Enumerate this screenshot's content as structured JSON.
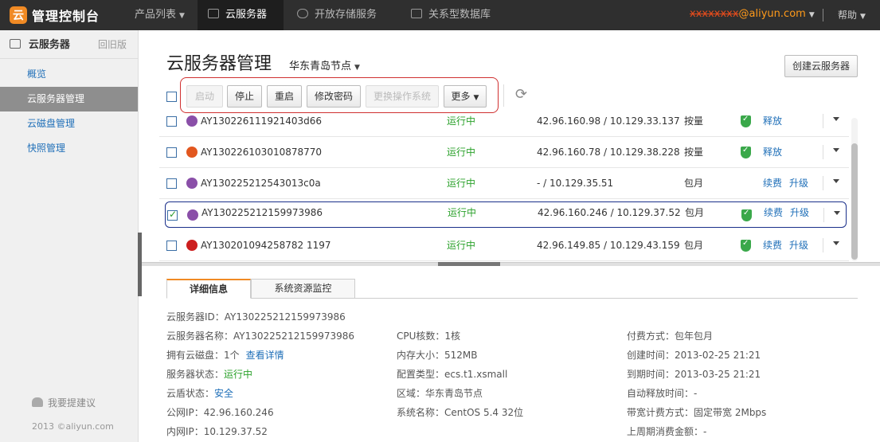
{
  "nav": {
    "logo_mark": "云",
    "logo_text": "管理控制台",
    "products": "产品列表",
    "ecs": "云服务器",
    "oss": "开放存储服务",
    "rds": "关系型数据库",
    "user_masked": "xxxxxxxx",
    "user_domain": "@aliyun.com",
    "help": "帮助"
  },
  "sidebar": {
    "title": "云服务器",
    "old_version": "回旧版",
    "items": [
      {
        "label": "概览"
      },
      {
        "label": "云服务器管理"
      },
      {
        "label": "云磁盘管理"
      },
      {
        "label": "快照管理"
      }
    ],
    "feedback": "我要提建议",
    "copyright": "2013 ©aliyun.com"
  },
  "page": {
    "title": "云服务器管理",
    "region": "华东青岛节点",
    "create_button": "创建云服务器"
  },
  "toolbar": {
    "start": "启动",
    "stop": "停止",
    "restart": "重启",
    "change_password": "修改密码",
    "change_os": "更换操作系统",
    "more": "更多"
  },
  "rows": [
    {
      "id": "AY130226111921403d66",
      "status": "运行中",
      "ip": "42.96.160.98 / 10.129.33.137",
      "billing": "按量",
      "a1": "释放",
      "a2": "",
      "os": "centos",
      "shield": true,
      "checked": false
    },
    {
      "id": "AY130226103010878770",
      "status": "运行中",
      "ip": "42.96.160.78 / 10.129.38.228",
      "billing": "按量",
      "a1": "释放",
      "a2": "",
      "os": "ubuntu",
      "shield": true,
      "checked": false
    },
    {
      "id": "AY130225212543013c0a",
      "status": "运行中",
      "ip": "- / 10.129.35.51",
      "billing": "包月",
      "a1": "续费",
      "a2": "升级",
      "os": "centos",
      "shield": false,
      "checked": false
    },
    {
      "id": "AY130225212159973986",
      "status": "运行中",
      "ip": "42.96.160.246 / 10.129.37.52",
      "billing": "包月",
      "a1": "续费",
      "a2": "升级",
      "os": "centos",
      "shield": true,
      "checked": true
    },
    {
      "id": "AY130201094258782 1197",
      "status": "运行中",
      "ip": "42.96.149.85 / 10.129.43.159",
      "billing": "包月",
      "a1": "续费",
      "a2": "升级",
      "os": "redhat",
      "shield": true,
      "checked": false
    }
  ],
  "detail": {
    "tab_info": "详细信息",
    "tab_monitor": "系统资源监控",
    "id_label": "云服务器ID：",
    "id": "AY130225212159973986",
    "col1": [
      {
        "k": "云服务器名称：",
        "v": "AY130225212159973986"
      },
      {
        "k": "拥有云磁盘：",
        "v": "1个"
      },
      {
        "k": "服务器状态：",
        "v": "运行中"
      },
      {
        "k": "云盾状态：",
        "v": "安全"
      },
      {
        "k": "公网IP：",
        "v": "42.96.160.246"
      },
      {
        "k": "内网IP：",
        "v": "10.129.37.52"
      }
    ],
    "view_details": "查看详情",
    "col2": [
      {
        "k": "CPU核数：",
        "v": "1核"
      },
      {
        "k": "内存大小：",
        "v": "512MB"
      },
      {
        "k": "配置类型：",
        "v": "ecs.t1.xsmall"
      },
      {
        "k": "区域：",
        "v": "华东青岛节点"
      },
      {
        "k": "系统名称：",
        "v": "CentOS 5.4 32位"
      }
    ],
    "col3": [
      {
        "k": "付费方式：",
        "v": "包年包月"
      },
      {
        "k": "创建时间：",
        "v": "2013-02-25  21:21"
      },
      {
        "k": "到期时间：",
        "v": "2013-03-25  21:21"
      },
      {
        "k": "自动释放时间：",
        "v": "-"
      },
      {
        "k": "带宽计费方式：",
        "v": "固定带宽 2Mbps"
      },
      {
        "k": "上周期消费金额：",
        "v": "-"
      }
    ]
  },
  "colors": {
    "accent": "#f08a24",
    "link": "#1f6fb8",
    "running": "#2aa12a",
    "highlight": "#d03030"
  }
}
